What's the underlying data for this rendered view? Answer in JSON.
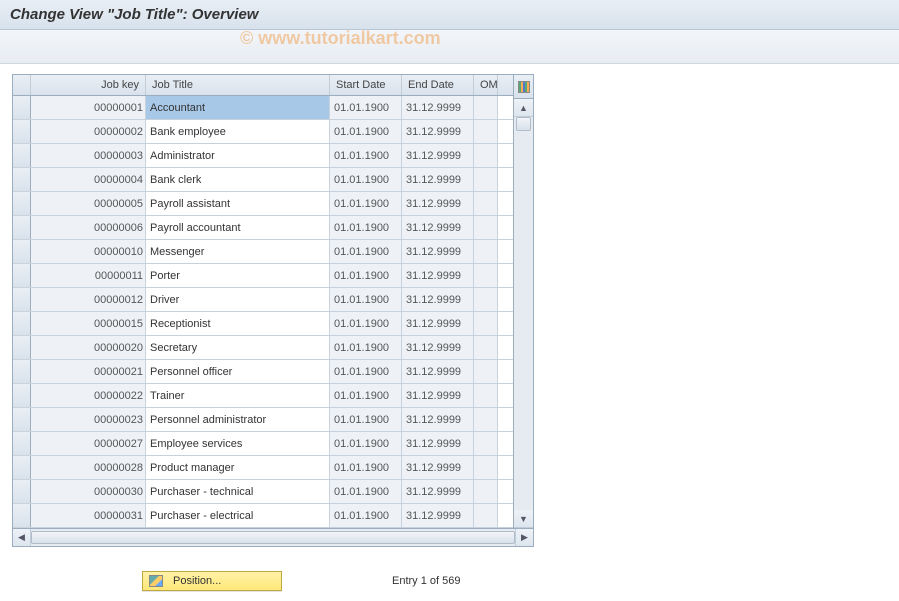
{
  "title": "Change View \"Job Title\": Overview",
  "watermark": "© www.tutorialkart.com",
  "columns": {
    "selector": "",
    "job_key": "Job key",
    "job_title": "Job Title",
    "start_date": "Start Date",
    "end_date": "End Date",
    "om": "OM"
  },
  "rows": [
    {
      "key": "00000001",
      "title": "Accountant",
      "start": "01.01.1900",
      "end": "31.12.9999",
      "om": "",
      "selected": true
    },
    {
      "key": "00000002",
      "title": "Bank employee",
      "start": "01.01.1900",
      "end": "31.12.9999",
      "om": ""
    },
    {
      "key": "00000003",
      "title": "Administrator",
      "start": "01.01.1900",
      "end": "31.12.9999",
      "om": ""
    },
    {
      "key": "00000004",
      "title": "Bank clerk",
      "start": "01.01.1900",
      "end": "31.12.9999",
      "om": ""
    },
    {
      "key": "00000005",
      "title": "Payroll assistant",
      "start": "01.01.1900",
      "end": "31.12.9999",
      "om": ""
    },
    {
      "key": "00000006",
      "title": "Payroll accountant",
      "start": "01.01.1900",
      "end": "31.12.9999",
      "om": ""
    },
    {
      "key": "00000010",
      "title": "Messenger",
      "start": "01.01.1900",
      "end": "31.12.9999",
      "om": ""
    },
    {
      "key": "00000011",
      "title": "Porter",
      "start": "01.01.1900",
      "end": "31.12.9999",
      "om": ""
    },
    {
      "key": "00000012",
      "title": "Driver",
      "start": "01.01.1900",
      "end": "31.12.9999",
      "om": ""
    },
    {
      "key": "00000015",
      "title": "Receptionist",
      "start": "01.01.1900",
      "end": "31.12.9999",
      "om": ""
    },
    {
      "key": "00000020",
      "title": "Secretary",
      "start": "01.01.1900",
      "end": "31.12.9999",
      "om": ""
    },
    {
      "key": "00000021",
      "title": "Personnel officer",
      "start": "01.01.1900",
      "end": "31.12.9999",
      "om": ""
    },
    {
      "key": "00000022",
      "title": "Trainer",
      "start": "01.01.1900",
      "end": "31.12.9999",
      "om": ""
    },
    {
      "key": "00000023",
      "title": "Personnel administrator",
      "start": "01.01.1900",
      "end": "31.12.9999",
      "om": ""
    },
    {
      "key": "00000027",
      "title": "Employee services",
      "start": "01.01.1900",
      "end": "31.12.9999",
      "om": ""
    },
    {
      "key": "00000028",
      "title": "Product manager",
      "start": "01.01.1900",
      "end": "31.12.9999",
      "om": ""
    },
    {
      "key": "00000030",
      "title": "Purchaser - technical",
      "start": "01.01.1900",
      "end": "31.12.9999",
      "om": ""
    },
    {
      "key": "00000031",
      "title": "Purchaser - electrical",
      "start": "01.01.1900",
      "end": "31.12.9999",
      "om": ""
    }
  ],
  "footer": {
    "position_label": "Position...",
    "entry_label": "Entry 1 of 569"
  }
}
